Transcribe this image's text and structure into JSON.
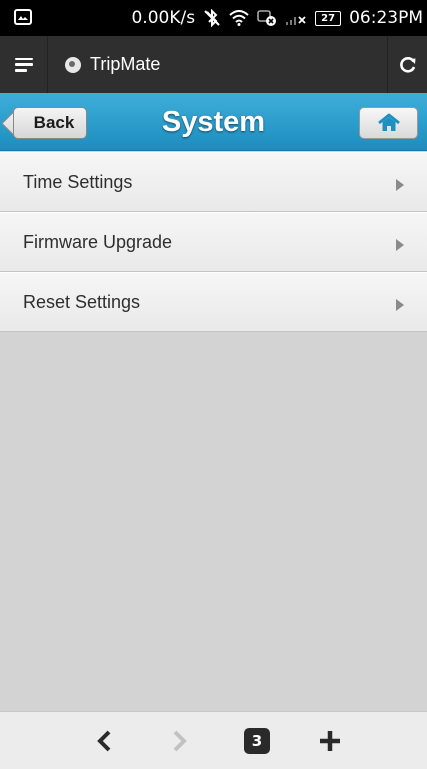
{
  "status_bar": {
    "net_speed": "0.00K/s",
    "battery": "27",
    "time": "06:23PM"
  },
  "browser": {
    "tab_title": "TripMate",
    "open_tabs": "3"
  },
  "header": {
    "back_label": "Back",
    "title": "System"
  },
  "menu": {
    "items": [
      {
        "label": "Time Settings"
      },
      {
        "label": "Firmware Upgrade"
      },
      {
        "label": "Reset Settings"
      }
    ]
  },
  "colors": {
    "header_blue": "#2a9fd0",
    "list_bg": "#f0f0f0",
    "page_bg": "#d3d3d3"
  },
  "icons": [
    "image-icon",
    "bluetooth-off-icon",
    "wifi-icon",
    "sync-off-icon",
    "signal-icon",
    "battery-icon",
    "menu-icon",
    "site-icon",
    "reload-icon",
    "home-icon",
    "chevron-right-icon",
    "back-arrow-icon",
    "forward-arrow-icon",
    "plus-icon"
  ]
}
